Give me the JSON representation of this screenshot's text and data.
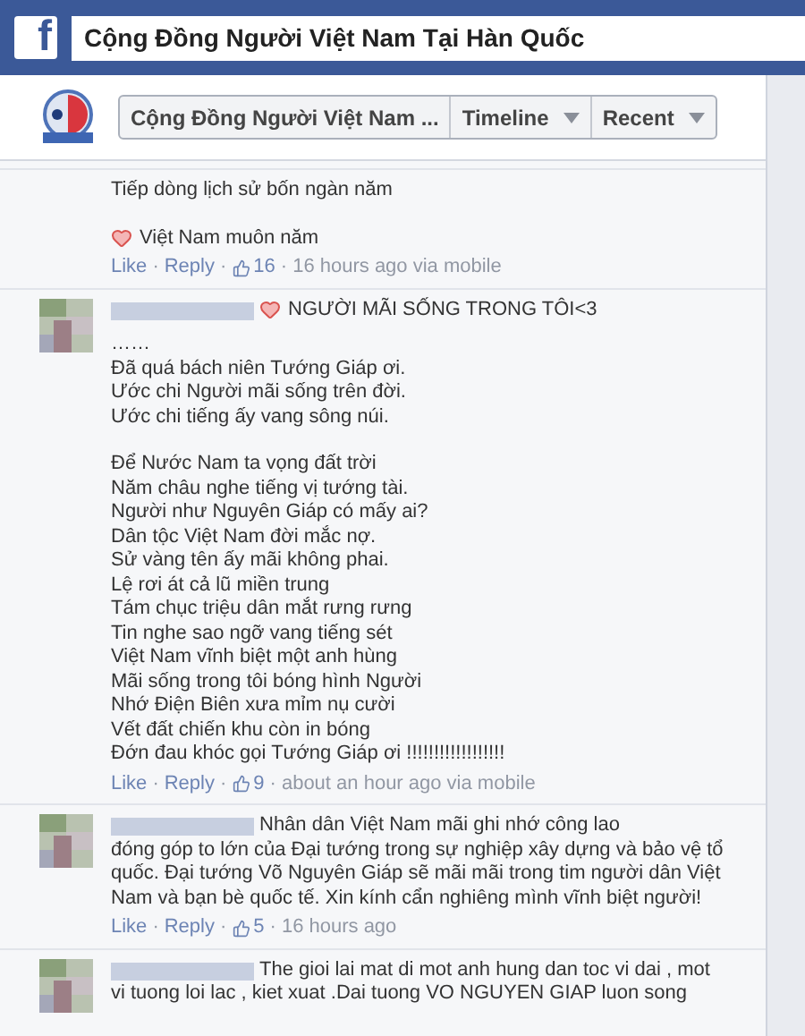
{
  "topbar": {
    "logo_letter": "f",
    "search_value": "Cộng Đồng Người Việt Nam Tại Hàn Quốc"
  },
  "nav": [
    {
      "label": "Cộng Đồng Người Việt Nam ...",
      "dropdown": false
    },
    {
      "label": "Timeline",
      "dropdown": true
    },
    {
      "label": "Recent",
      "dropdown": true
    }
  ],
  "comments": [
    {
      "avatar": false,
      "paragraphs": [
        [
          {
            "text": "Tiếp dòng lịch sử bốn ngàn năm",
            "heart": false
          }
        ],
        [
          {
            "text": "Việt Nam muôn năm",
            "heart": true
          }
        ]
      ],
      "meta": {
        "separator": "·",
        "like": "Like",
        "reply": "Reply",
        "likes": "16",
        "time": "16 hours ago via mobile"
      }
    },
    {
      "avatar": true,
      "paragraphs": [
        [
          {
            "text": "NGƯỜI MÃI SỐNG TRONG TÔI<3",
            "heart": true
          }
        ],
        [
          {
            "text": "……",
            "heart": false
          },
          {
            "text": "Đã quá bách niên Tướng Giáp ơi.",
            "heart": false
          },
          {
            "text": "Ước chi Người mãi sống trên đời.",
            "heart": false
          },
          {
            "text": "Ước chi tiếng ấy vang sông núi.",
            "heart": false
          }
        ],
        [
          {
            "text": "Để Nước Nam ta vọng đất trời",
            "heart": false
          },
          {
            "text": "Năm châu nghe tiếng vị tướng tài.",
            "heart": false
          },
          {
            "text": "Người như Nguyên Giáp có mấy ai?",
            "heart": false
          },
          {
            "text": "Dân tộc Việt Nam đời mắc nợ.",
            "heart": false
          },
          {
            "text": "Sử vàng tên ấy mãi không phai.",
            "heart": false
          },
          {
            "text": "Lệ rơi át cả lũ miền trung",
            "heart": false
          },
          {
            "text": "Tám chục triệu dân mắt rưng rưng",
            "heart": false
          },
          {
            "text": "Tin nghe sao ngỡ vang tiếng sét",
            "heart": false
          },
          {
            "text": "Việt Nam vĩnh biệt một anh hùng",
            "heart": false
          },
          {
            "text": "Mãi sống trong tôi bóng hình Người",
            "heart": false
          },
          {
            "text": "Nhớ Điện Biên xưa mỉm nụ cười",
            "heart": false
          },
          {
            "text": "Vết đất chiến khu còn in bóng",
            "heart": false
          },
          {
            "text": "Đớn đau khóc gọi Tướng Giáp ơi !!!!!!!!!!!!!!!!!!",
            "heart": false
          }
        ]
      ],
      "meta": {
        "separator": "·",
        "like": "Like",
        "reply": "Reply",
        "likes": "9",
        "time": "about an hour ago via mobile"
      }
    },
    {
      "avatar": true,
      "paragraphs": [
        [
          {
            "text": "Nhân dân Việt Nam mãi ghi nhớ công lao",
            "heart": false
          },
          {
            "text": "đóng góp to lớn của Đại tướng trong sự nghiệp xây dựng và bảo vệ tổ quốc. Đại tướng Võ Nguyên Giáp sẽ mãi mãi trong tim người dân Việt Nam và bạn bè quốc tế. Xin kính cẩn nghiêng mình vĩnh biệt người!",
            "heart": false
          }
        ]
      ],
      "meta": {
        "separator": "·",
        "like": "Like",
        "reply": "Reply",
        "likes": "5",
        "time": "16 hours ago"
      }
    },
    {
      "avatar": true,
      "paragraphs": [
        [
          {
            "text": "The gioi lai mat di mot anh hung dan toc vi dai , mot",
            "heart": false
          },
          {
            "text": "vi tuong loi lac , kiet xuat .Dai tuong VO NGUYEN GIAP luon song",
            "heart": false
          }
        ]
      ]
    }
  ]
}
